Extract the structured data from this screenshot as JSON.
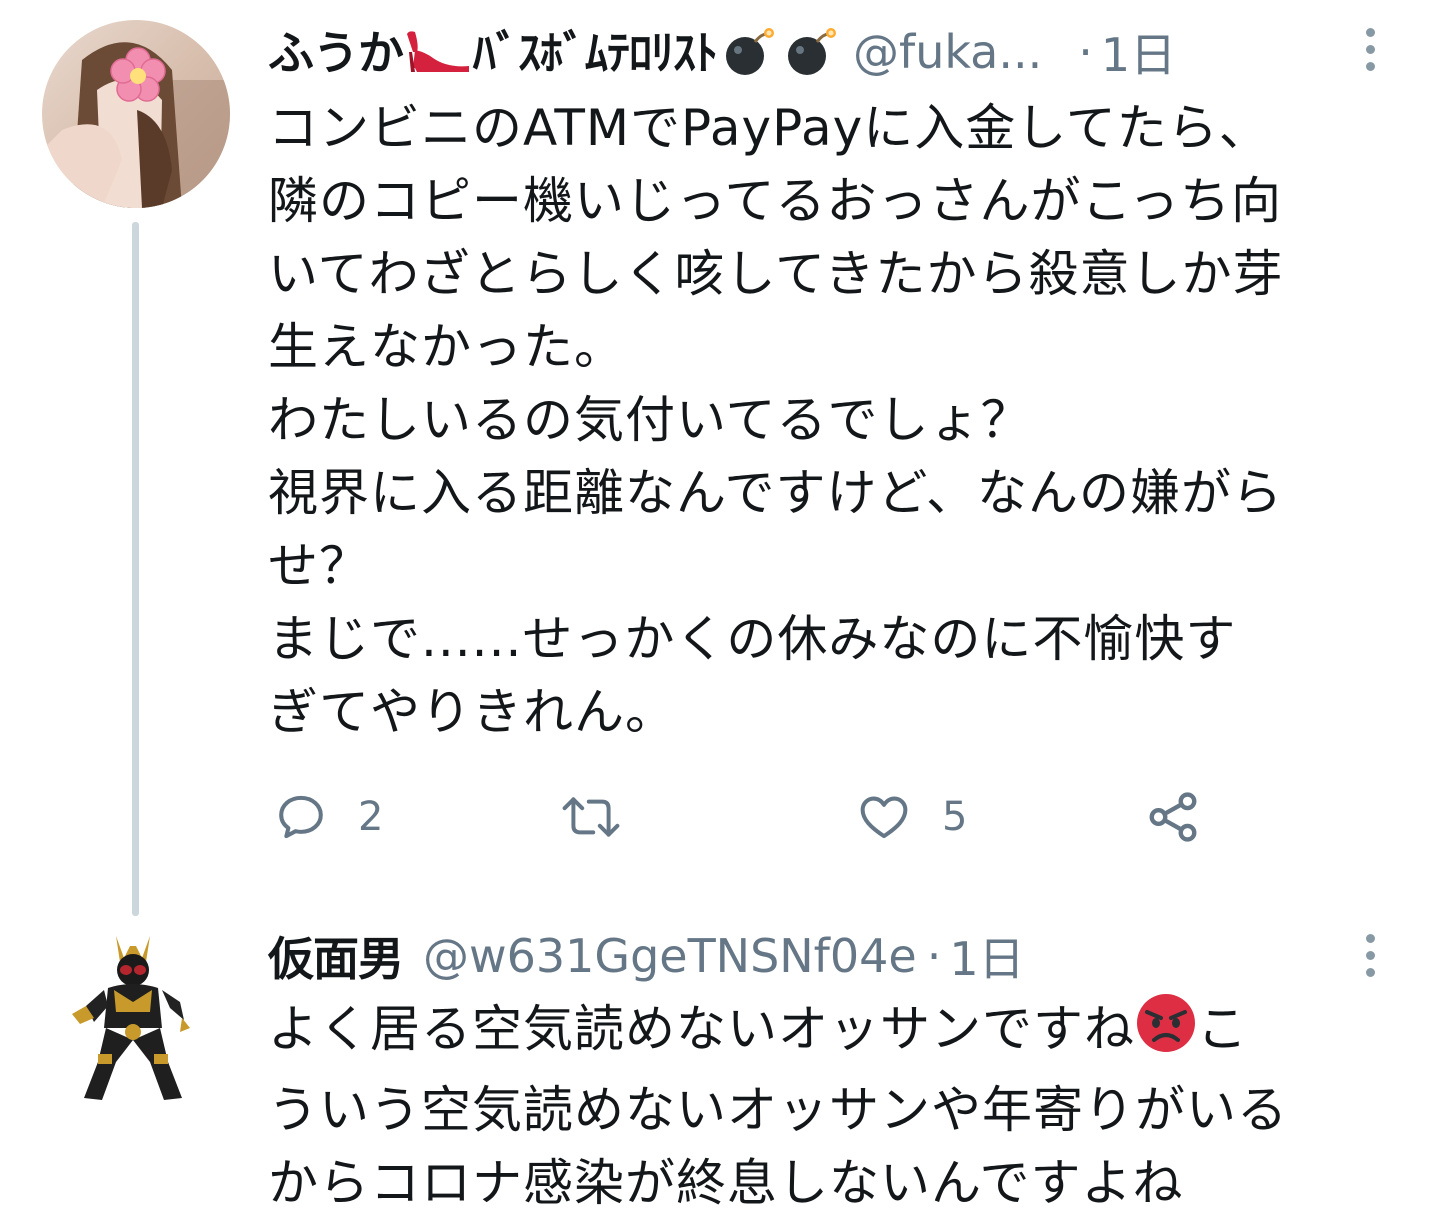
{
  "tweet1": {
    "display_name": "ふうか👠ﾊﾞｽﾎﾞﾑﾃﾛﾘｽﾄ💣💣",
    "display_name_text": "ふうか",
    "display_name_text2": "ﾊﾞｽﾎﾞﾑﾃﾛﾘｽﾄ",
    "handle": "@fuka...",
    "separator": "·",
    "time": "1日",
    "lines": [
      "コンビニのATMでPayPayに入金してたら、",
      "隣のコピー機いじってるおっさんがこっち向",
      "いてわざとらしく咳してきたから殺意しか芽",
      "生えなかった。",
      "わたしいるの気付いてるでしょ？",
      "視界に入る距離なんですけど、なんの嫌がら",
      "せ？",
      "まじで......せっかくの休みなのに不愉快す",
      "ぎてやりきれん。"
    ],
    "actions": {
      "reply_count": "2",
      "retweet_count": "",
      "like_count": "5"
    },
    "icons": {
      "heel": "high-heel-icon",
      "bomb": "bomb-icon",
      "reply": "reply-icon",
      "retweet": "retweet-icon",
      "like": "heart-icon",
      "share": "share-icon",
      "more": "more-vertical-icon"
    }
  },
  "tweet2": {
    "display_name": "仮面男",
    "handle": "@w631GgeTNSNf04e",
    "separator": "·",
    "time": "1日",
    "line1_before": "よく居る空気読めないオッサンですね",
    "line1_after": "こ",
    "lines": [
      "ういう空気読めないオッサンや年寄りがいる",
      "からコロナ感染が終息しないんですよね"
    ],
    "icons": {
      "angry": "angry-face-icon",
      "more": "more-vertical-icon"
    }
  },
  "colors": {
    "text": "#14171a",
    "secondary": "#657786",
    "thread_line": "#ccd6dd",
    "heel_red": "#e0245e",
    "angry_red": "#e0243a"
  }
}
